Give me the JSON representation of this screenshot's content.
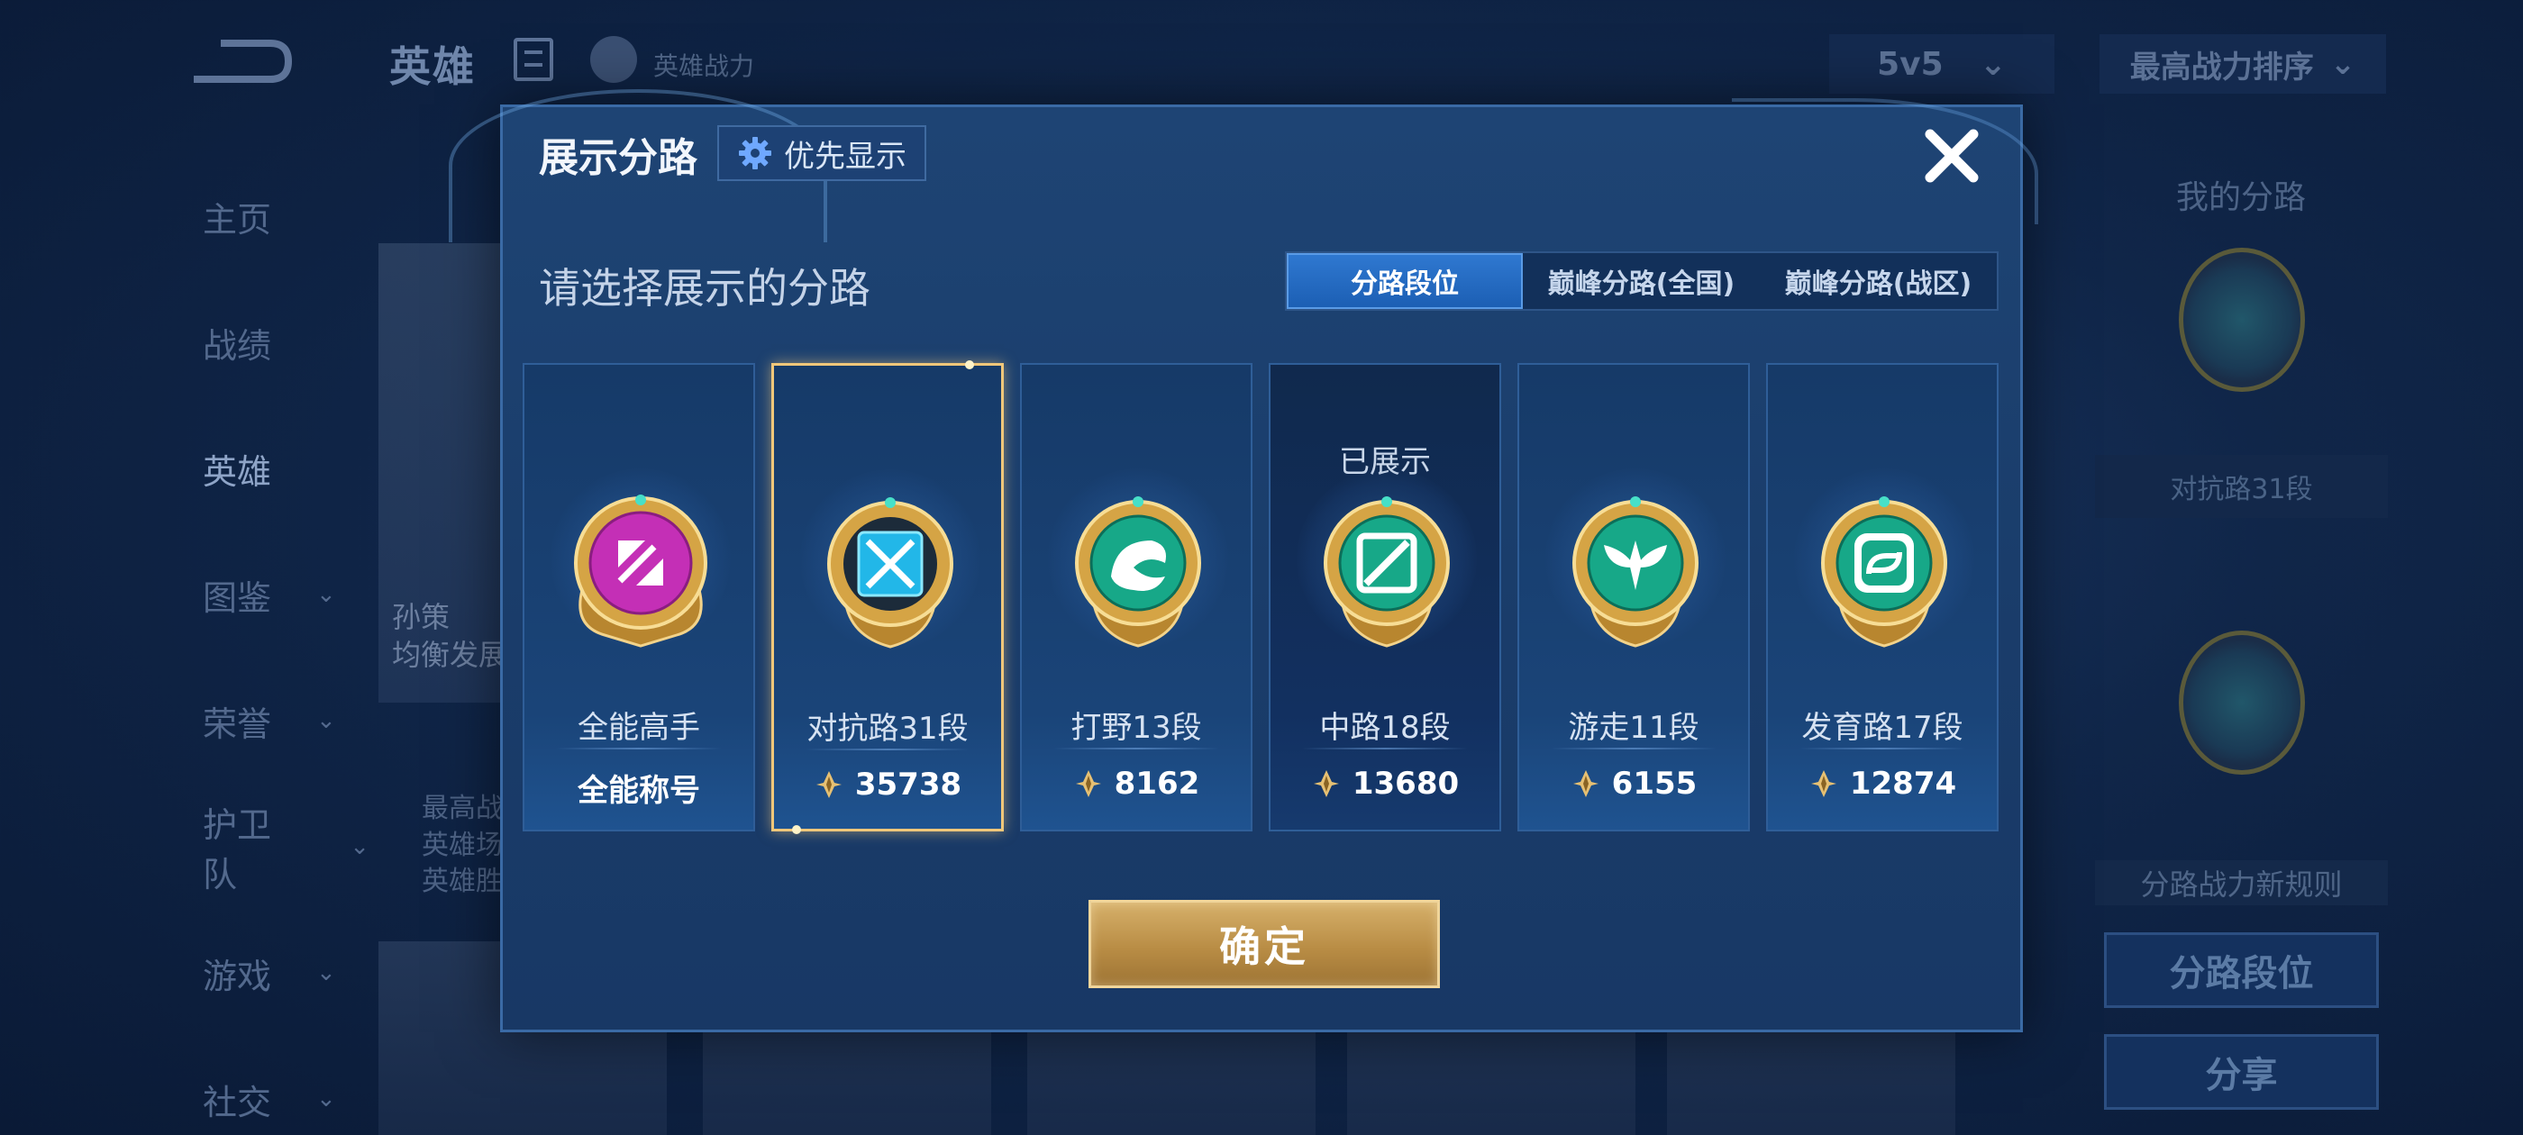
{
  "background": {
    "page_title": "英雄",
    "power_label": "英雄战力",
    "mode_select": "5v5",
    "sort_select": "最高战力排序",
    "nav": [
      {
        "label": "主页",
        "chevron": false
      },
      {
        "label": "战绩",
        "chevron": false
      },
      {
        "label": "英雄",
        "chevron": false,
        "active": true
      },
      {
        "label": "图鉴",
        "chevron": true
      },
      {
        "label": "荣誉",
        "chevron": true
      },
      {
        "label": "护卫队",
        "chevron": true
      },
      {
        "label": "游戏",
        "chevron": true
      },
      {
        "label": "社交",
        "chevron": true
      }
    ],
    "hero_card_text": [
      "孙策",
      "均衡发展"
    ],
    "hero_stats": [
      "最高战",
      "英雄场",
      "英雄胜"
    ],
    "right_panel": {
      "title": "我的分路",
      "current_label": "对抗路31段",
      "rule_text": "分路战力新规则",
      "rank_button": "分路段位",
      "share_button": "分享"
    }
  },
  "modal": {
    "title": "展示分路",
    "priority_button": "优先显示",
    "section_title": "请选择展示的分路",
    "tabs": [
      {
        "label": "分路段位",
        "active": true
      },
      {
        "label": "巅峰分路(全国)",
        "active": false
      },
      {
        "label": "巅峰分路(战区)",
        "active": false
      }
    ],
    "cards": [
      {
        "role": "全能高手",
        "value": "全能称号",
        "has_power": false,
        "emblem": "allround-emblem-icon",
        "color": "#c42fb6",
        "selected": false,
        "shown": false
      },
      {
        "role": "对抗路31段",
        "value": "35738",
        "has_power": true,
        "emblem": "clash-lane-emblem-icon",
        "color": "#22b7e8",
        "selected": true,
        "shown": false
      },
      {
        "role": "打野13段",
        "value": "8162",
        "has_power": true,
        "emblem": "jungle-emblem-icon",
        "color": "#17a888",
        "selected": false,
        "shown": false
      },
      {
        "role": "中路18段",
        "value": "13680",
        "has_power": true,
        "emblem": "mid-lane-emblem-icon",
        "color": "#17a888",
        "selected": false,
        "shown": true,
        "shown_label": "已展示"
      },
      {
        "role": "游走11段",
        "value": "6155",
        "has_power": true,
        "emblem": "roam-emblem-icon",
        "color": "#17a888",
        "selected": false,
        "shown": false
      },
      {
        "role": "发育路17段",
        "value": "12874",
        "has_power": true,
        "emblem": "farm-lane-emblem-icon",
        "color": "#17a888",
        "selected": false,
        "shown": false
      }
    ],
    "confirm_button": "确定"
  }
}
